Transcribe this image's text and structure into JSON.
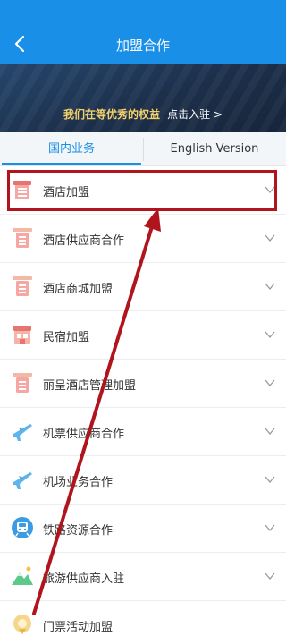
{
  "header": {
    "title": "加盟合作"
  },
  "banner": {
    "text": "我们在等优秀的权益",
    "link": "点击入驻 >"
  },
  "tabs": [
    {
      "label": "国内业务",
      "active": true
    },
    {
      "label": "English Version",
      "active": false
    }
  ],
  "items": [
    {
      "label": "酒店加盟",
      "icon": "hotel-icon"
    },
    {
      "label": "酒店供应商合作",
      "icon": "supplies-icon"
    },
    {
      "label": "酒店商城加盟",
      "icon": "supplies-icon"
    },
    {
      "label": "民宿加盟",
      "icon": "homestay-icon"
    },
    {
      "label": "丽呈酒店管理加盟",
      "icon": "supplies-icon"
    },
    {
      "label": "机票供应商合作",
      "icon": "airplane-icon"
    },
    {
      "label": "机场业务合作",
      "icon": "airplane-icon"
    },
    {
      "label": "铁路资源合作",
      "icon": "train-icon"
    },
    {
      "label": "旅游供应商入驻",
      "icon": "mountain-icon"
    },
    {
      "label": "门票活动加盟",
      "icon": "ticket-icon"
    }
  ],
  "colors": {
    "accent": "#1a8fe8",
    "annotation": "#b0141c"
  }
}
